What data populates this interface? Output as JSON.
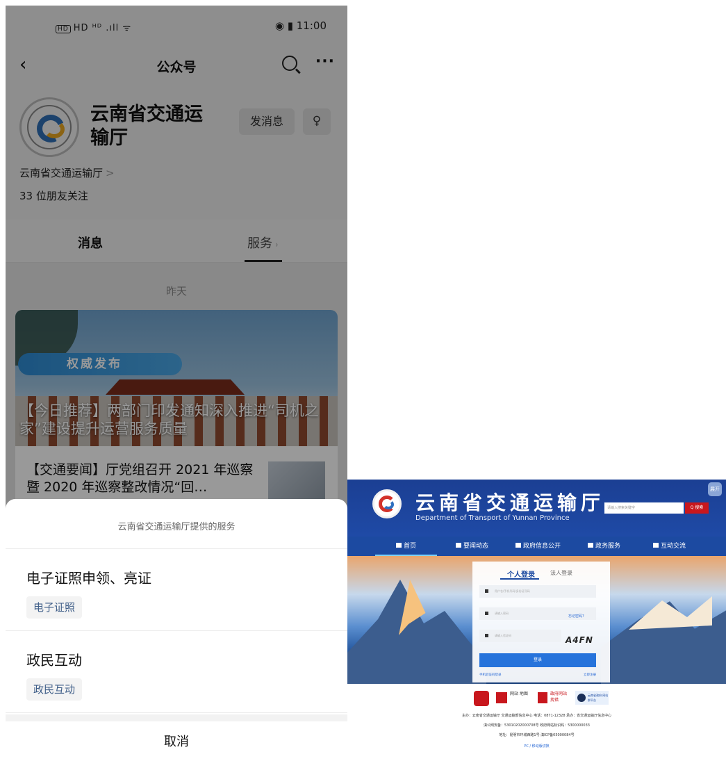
{
  "phone": {
    "status_bar": {
      "left": "HD ᴴᴰ .ıll ᯤ",
      "time": "11:00",
      "icons_right": "◉ ▮"
    },
    "nav": {
      "title": "公众号",
      "back_icon": "‹",
      "more": "···"
    },
    "account": {
      "name": "云南省交通运输厅",
      "send_message": "发消息",
      "owner_entity": "云南省交通运输厅",
      "chevron": ">",
      "followers": "33 位朋友关注"
    },
    "tabs": {
      "messages": "消息",
      "services": "服务"
    },
    "feed": {
      "date_label": "昨天",
      "banner_badge": "权威发布",
      "headline": "【今日推荐】两部门印发通知深入推进“司机之家”建设提升运营服务质量",
      "item2_title": "【交通要闻】厅党组召开 2021 年巡察暨 2020 年巡察整改情况“回…"
    },
    "sheet": {
      "header": "云南省交通运输厅提供的服务",
      "services": [
        {
          "name": "电子证照申领、亮证",
          "tag": "电子证照"
        },
        {
          "name": "政民互动",
          "tag": "政民互动"
        }
      ],
      "cancel": "取消"
    }
  },
  "site": {
    "title": "云南省交通运输厅",
    "subtitle": "Department of Transport of Yunnan Province",
    "search_placeholder": "请输入搜索关键字",
    "search_button": "Q 搜索",
    "corner_button": "展开",
    "nav": [
      "首页",
      "要闻动态",
      "政府信息公开",
      "政务服务",
      "互动交流"
    ],
    "login": {
      "tab_personal": "个人登录",
      "tab_legal": "法人登录",
      "username_placeholder": "用户名/手机号码/身份证号码",
      "password_placeholder": "请输入密码",
      "forgot": "忘记密码?",
      "captcha_placeholder": "请输入验证码",
      "captcha": "A4FN",
      "login_button": "登录",
      "sms_login": "手机验证码登录",
      "register": "立即注册"
    },
    "footer": {
      "badge_sitemap": "网站 地图",
      "badge_error": "政府网站 找错",
      "badge_yunnan": "云南省政府 网站群平台",
      "line1": "主办：云南省交通运输厅 交通运输部信息中心 电话：0871-12328 承办：省交通运输厅信息中心",
      "line2": "滇公网安备：53010202000708号 政府网站标识码：5300000033",
      "line3": "地址：昆明市环城西路1号 滇ICP备05000084号",
      "line4": "PC / 移动版切换"
    }
  }
}
